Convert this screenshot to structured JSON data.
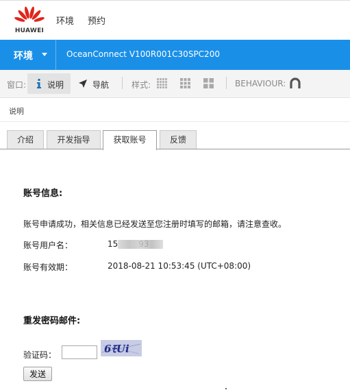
{
  "header": {
    "brand": "HUAWEI",
    "nav": [
      "环境",
      "预约"
    ]
  },
  "env_bar": {
    "env_label": "环境",
    "version": "OceanConnect V100R001C30SPC200",
    "color": "#1a8fe8"
  },
  "toolbar": {
    "window_label": "窗口:",
    "info_button": "说明",
    "nav_button": "导航",
    "style_label": "样式:",
    "behaviour_label": "BEHAVIOUR:"
  },
  "breadcrumb": "说明",
  "tabs": [
    "介绍",
    "开发指导",
    "获取账号",
    "反馈"
  ],
  "active_tab": "获取账号",
  "account": {
    "title": "账号信息:",
    "message": "账号申请成功，相关信息已经发送至您注册时填写的邮箱，请注意查收。",
    "username_label": "账号用户名：",
    "username_value": "15     93",
    "expiry_label": "账号有效期：",
    "expiry_value": "2018-08-21 10:53:45 (UTC+08:00)"
  },
  "resend": {
    "title": "重发密码邮件:",
    "captcha_label": "验证码：",
    "captcha_value": "",
    "captcha_text": "6ﾓUi",
    "send_button": "发送"
  }
}
